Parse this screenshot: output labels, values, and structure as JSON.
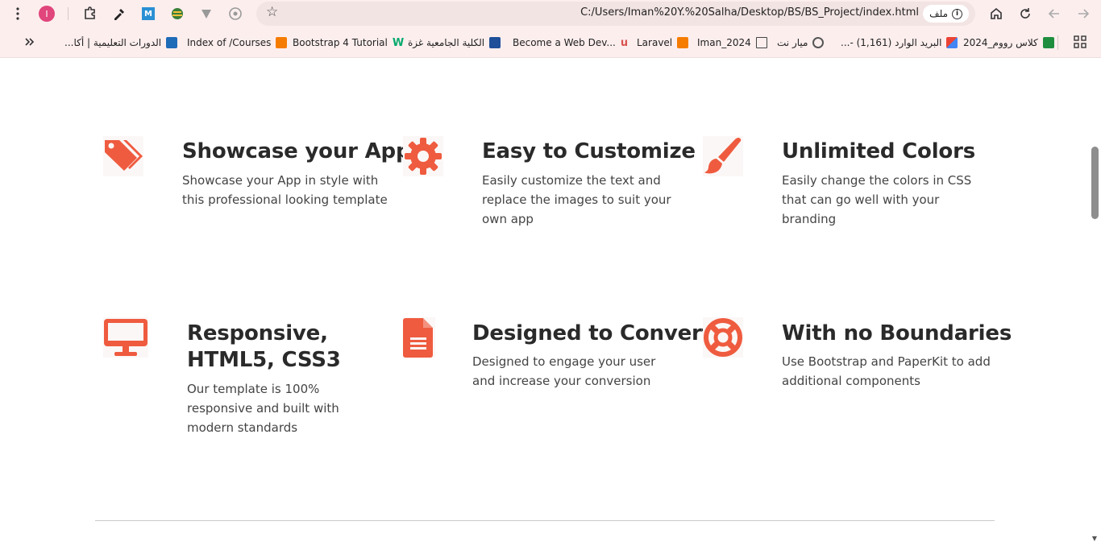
{
  "browser": {
    "url": "C:/Users/Iman%20Y.%20Salha/Desktop/BS/BS_Project/index.html",
    "site_info_label": "ملف",
    "profile_initial": "I",
    "bookmarks": [
      {
        "label": "كلاس رووم_2024",
        "icon": "classroom-icon",
        "color": "#1e8e3e"
      },
      {
        "label": "البريد الوارد (1,161) -...",
        "icon": "gmail-icon",
        "color": "#d93025"
      },
      {
        "label": "ميار نت",
        "icon": "wifi-icon",
        "color": "#555555"
      },
      {
        "label": "Iman_2024",
        "icon": "folder-icon",
        "color": "#444444"
      },
      {
        "label": "Laravel",
        "icon": "xampp-icon",
        "color": "#f57c00"
      },
      {
        "label": "Become a Web Dev...",
        "icon": "udemy-icon",
        "color": "#d9534f"
      },
      {
        "label": "الكلية الجامعية غزة",
        "icon": "college-icon",
        "color": "#1f4f99"
      },
      {
        "label": "Bootstrap 4 Tutorial",
        "icon": "w3schools-icon",
        "color": "#04aa6d"
      },
      {
        "label": "Index of /Courses",
        "icon": "xampp-icon",
        "color": "#f57c00"
      },
      {
        "label": "الدورات التعليمية | أكا...",
        "icon": "edu-icon",
        "color": "#1e6bb8"
      }
    ]
  },
  "features": [
    {
      "title": "Showcase your App",
      "desc": "Showcase your App in style with this professional looking template",
      "icon": "tags-icon"
    },
    {
      "title": "Easy to Customize",
      "desc": "Easily customize the text and replace the images to suit your own app",
      "icon": "gear-icon"
    },
    {
      "title": "Unlimited Colors",
      "desc": "Easily change the colors in CSS that can go well with your branding",
      "icon": "paint-brush-icon"
    },
    {
      "title": "Responsive, HTML5, CSS3",
      "desc": "Our template is 100% responsive and built with modern standards",
      "icon": "monitor-icon"
    },
    {
      "title": "Designed to Convert",
      "desc": "Designed to engage your user and increase your conversion",
      "icon": "document-icon"
    },
    {
      "title": "With no Boundaries",
      "desc": "Use Bootstrap and PaperKit to add additional components",
      "icon": "lifebuoy-icon"
    }
  ],
  "colors": {
    "accent": "#ef5b3f"
  }
}
